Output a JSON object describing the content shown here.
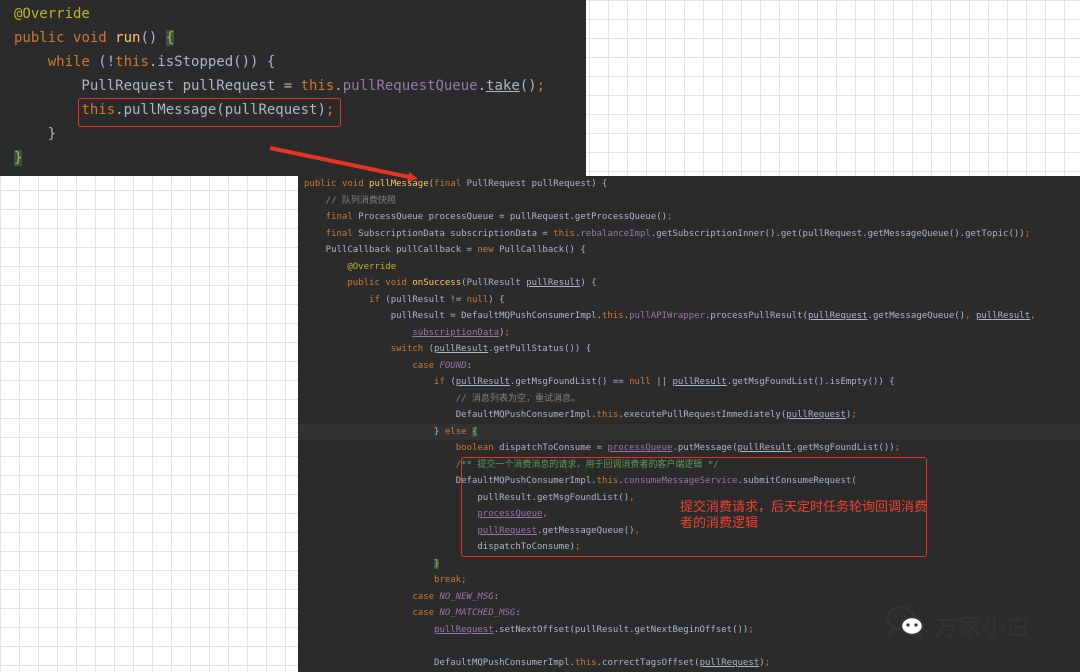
{
  "colors": {
    "editor_bg": "#2b2b2b",
    "keyword": "#cc7832",
    "annotation": "#bbb529",
    "method_decl": "#ffc66d",
    "field": "#9876aa",
    "comment": "#808080",
    "plain": "#a9b7c6",
    "highlight": "#e53524"
  },
  "snippet_top": {
    "lines": [
      [
        {
          "t": "@Override",
          "c": "a"
        }
      ],
      [
        {
          "t": "public ",
          "c": "k"
        },
        {
          "t": "void ",
          "c": "k"
        },
        {
          "t": "run",
          "c": "f"
        },
        {
          "t": "() ",
          "c": "d"
        },
        {
          "t": "{",
          "c": "bh"
        }
      ],
      [
        {
          "t": "    while ",
          "c": "k"
        },
        {
          "t": "(!",
          "c": "d"
        },
        {
          "t": "this",
          "c": "k"
        },
        {
          "t": ".isStopped()) {",
          "c": "d"
        }
      ],
      [
        {
          "t": "        PullRequest pullRequest = ",
          "c": "d"
        },
        {
          "t": "this",
          "c": "k"
        },
        {
          "t": ".",
          "c": "d"
        },
        {
          "t": "pullRequestQueue",
          "c": "p"
        },
        {
          "t": ".",
          "c": "d"
        },
        {
          "t": "take",
          "c": "du"
        },
        {
          "t": "()",
          "c": "d"
        },
        {
          "t": ";",
          "c": "k"
        }
      ],
      [
        {
          "t": "        ",
          "c": "d"
        },
        {
          "t": "this",
          "c": "k"
        },
        {
          "t": ".pullMessage(pullRequest)",
          "c": "d"
        },
        {
          "t": ";",
          "c": "k"
        }
      ],
      [
        {
          "t": "    }",
          "c": "d"
        }
      ],
      [
        {
          "t": "}",
          "c": "bh"
        }
      ]
    ]
  },
  "snippet_bottom": {
    "lines": [
      [
        {
          "t": "public ",
          "c": "k"
        },
        {
          "t": "void ",
          "c": "k"
        },
        {
          "t": "pullMessage",
          "c": "f"
        },
        {
          "t": "(",
          "c": "d"
        },
        {
          "t": "final ",
          "c": "k"
        },
        {
          "t": "PullRequest pullRequest) {",
          "c": "d"
        }
      ],
      [
        {
          "t": "    // 队列消费快照",
          "c": "c"
        }
      ],
      [
        {
          "t": "    final ",
          "c": "k"
        },
        {
          "t": "ProcessQueue processQueue = pullRequest.getProcessQueue()",
          "c": "d"
        },
        {
          "t": ";",
          "c": "k"
        }
      ],
      [
        {
          "t": "    final ",
          "c": "k"
        },
        {
          "t": "SubscriptionData subscriptionData = ",
          "c": "d"
        },
        {
          "t": "this",
          "c": "k"
        },
        {
          "t": ".",
          "c": "d"
        },
        {
          "t": "rebalanceImpl",
          "c": "p"
        },
        {
          "t": ".getSubscriptionInner().get(pullRequest.getMessageQueue().getTopic())",
          "c": "d"
        },
        {
          "t": ";",
          "c": "k"
        }
      ],
      [
        {
          "t": "    PullCallback pullCallback = ",
          "c": "d"
        },
        {
          "t": "new ",
          "c": "k"
        },
        {
          "t": "PullCallback() {",
          "c": "d"
        }
      ],
      [
        {
          "t": "        @Override",
          "c": "a"
        }
      ],
      [
        {
          "t": "        public ",
          "c": "k"
        },
        {
          "t": "void ",
          "c": "k"
        },
        {
          "t": "onSuccess",
          "c": "f"
        },
        {
          "t": "(PullResult ",
          "c": "d"
        },
        {
          "t": "pullResult",
          "c": "du"
        },
        {
          "t": ") {",
          "c": "d"
        }
      ],
      [
        {
          "t": "            if ",
          "c": "k"
        },
        {
          "t": "(pullResult != ",
          "c": "d"
        },
        {
          "t": "null",
          "c": "k"
        },
        {
          "t": ") {",
          "c": "d"
        }
      ],
      [
        {
          "t": "                pullResult = DefaultMQPushConsumerImpl.",
          "c": "d"
        },
        {
          "t": "this",
          "c": "k"
        },
        {
          "t": ".",
          "c": "d"
        },
        {
          "t": "pullAPIWrapper",
          "c": "p"
        },
        {
          "t": ".processPullResult(",
          "c": "d"
        },
        {
          "t": "pullRequest",
          "c": "du"
        },
        {
          "t": ".getMessageQueue()",
          "c": "d"
        },
        {
          "t": ", ",
          "c": "k"
        },
        {
          "t": "pullResult",
          "c": "du"
        },
        {
          "t": ",",
          "c": "k"
        }
      ],
      [
        {
          "t": "                    ",
          "c": "d"
        },
        {
          "t": "subscriptionData",
          "c": "pu"
        },
        {
          "t": ")",
          "c": "d"
        },
        {
          "t": ";",
          "c": "k"
        }
      ],
      [
        {
          "t": "                switch ",
          "c": "k"
        },
        {
          "t": "(",
          "c": "d"
        },
        {
          "t": "pullResult",
          "c": "du"
        },
        {
          "t": ".getPullStatus()) {",
          "c": "d"
        }
      ],
      [
        {
          "t": "                    case ",
          "c": "k"
        },
        {
          "t": "FOUND",
          "c": "pi"
        },
        {
          "t": ":",
          "c": "d"
        }
      ],
      [
        {
          "t": "                        if ",
          "c": "k"
        },
        {
          "t": "(",
          "c": "d"
        },
        {
          "t": "pullResult",
          "c": "du"
        },
        {
          "t": ".getMsgFoundList() == ",
          "c": "d"
        },
        {
          "t": "null ",
          "c": "k"
        },
        {
          "t": "|| ",
          "c": "d"
        },
        {
          "t": "pullResult",
          "c": "du"
        },
        {
          "t": ".getMsgFoundList().isEmpty()) {",
          "c": "d"
        }
      ],
      [
        {
          "t": "                            // 消息列表为空，重试消息。",
          "c": "c"
        }
      ],
      [
        {
          "t": "                            DefaultMQPushConsumerImpl.",
          "c": "d"
        },
        {
          "t": "this",
          "c": "k"
        },
        {
          "t": ".executePullRequestImmediately(",
          "c": "d"
        },
        {
          "t": "pullRequest",
          "c": "du"
        },
        {
          "t": ")",
          "c": "d"
        },
        {
          "t": ";",
          "c": "k"
        }
      ],
      [
        {
          "t": "                        } ",
          "c": "d"
        },
        {
          "t": "else ",
          "c": "k"
        },
        {
          "t": "{",
          "c": "bh"
        }
      ],
      [
        {
          "t": "                            boolean ",
          "c": "k"
        },
        {
          "t": "dispatchToConsume = ",
          "c": "d"
        },
        {
          "t": "processQueue",
          "c": "pu"
        },
        {
          "t": ".putMessage(",
          "c": "d"
        },
        {
          "t": "pullResult",
          "c": "du"
        },
        {
          "t": ".getMsgFoundList())",
          "c": "d"
        },
        {
          "t": ";",
          "c": "k"
        }
      ],
      [
        {
          "t": "                            ",
          "c": "d"
        },
        {
          "t": "/**",
          "c": "cb"
        },
        {
          "t": " 提交一个消费消息的请求，用于回调消费者的客户端逻辑 */",
          "c": "cb"
        }
      ],
      [
        {
          "t": "                            DefaultMQPushConsumerImpl.",
          "c": "d"
        },
        {
          "t": "this",
          "c": "k"
        },
        {
          "t": ".",
          "c": "d"
        },
        {
          "t": "consumeMessageService",
          "c": "p"
        },
        {
          "t": ".submitConsumeRequest(",
          "c": "d"
        }
      ],
      [
        {
          "t": "                                pullResult.getMsgFoundList()",
          "c": "d"
        },
        {
          "t": ",",
          "c": "k"
        }
      ],
      [
        {
          "t": "                                ",
          "c": "d"
        },
        {
          "t": "processQueue",
          "c": "pu"
        },
        {
          "t": ",",
          "c": "k"
        }
      ],
      [
        {
          "t": "                                ",
          "c": "d"
        },
        {
          "t": "pullRequest",
          "c": "pu"
        },
        {
          "t": ".getMessageQueue()",
          "c": "d"
        },
        {
          "t": ",",
          "c": "k"
        }
      ],
      [
        {
          "t": "                                dispatchToConsume)",
          "c": "d"
        },
        {
          "t": ";",
          "c": "k"
        }
      ],
      [
        {
          "t": "                        ",
          "c": "d"
        },
        {
          "t": "}",
          "c": "bh"
        }
      ],
      [
        {
          "t": "                        break;",
          "c": "k"
        }
      ],
      [
        {
          "t": "                    case ",
          "c": "k"
        },
        {
          "t": "NO_NEW_MSG",
          "c": "pi"
        },
        {
          "t": ":",
          "c": "d"
        }
      ],
      [
        {
          "t": "                    case ",
          "c": "k"
        },
        {
          "t": "NO_MATCHED_MSG",
          "c": "pi"
        },
        {
          "t": ":",
          "c": "d"
        }
      ],
      [
        {
          "t": "                        ",
          "c": "d"
        },
        {
          "t": "pullRequest",
          "c": "pu"
        },
        {
          "t": ".setNextOffset(pullResult.getNextBeginOffset())",
          "c": "d"
        },
        {
          "t": ";",
          "c": "k"
        }
      ],
      [],
      [
        {
          "t": "                        DefaultMQPushConsumerImpl.",
          "c": "d"
        },
        {
          "t": "this",
          "c": "k"
        },
        {
          "t": ".correctTagsOffset(",
          "c": "d"
        },
        {
          "t": "pullRequest",
          "c": "du"
        },
        {
          "t": ")",
          "c": "d"
        },
        {
          "t": ";",
          "c": "k"
        }
      ]
    ]
  },
  "annotation_note": "提交消费请求，后天定时任务轮询回调消费者的消费逻辑",
  "brand": {
    "icon": "wechat-icon",
    "name": "方家小白"
  }
}
